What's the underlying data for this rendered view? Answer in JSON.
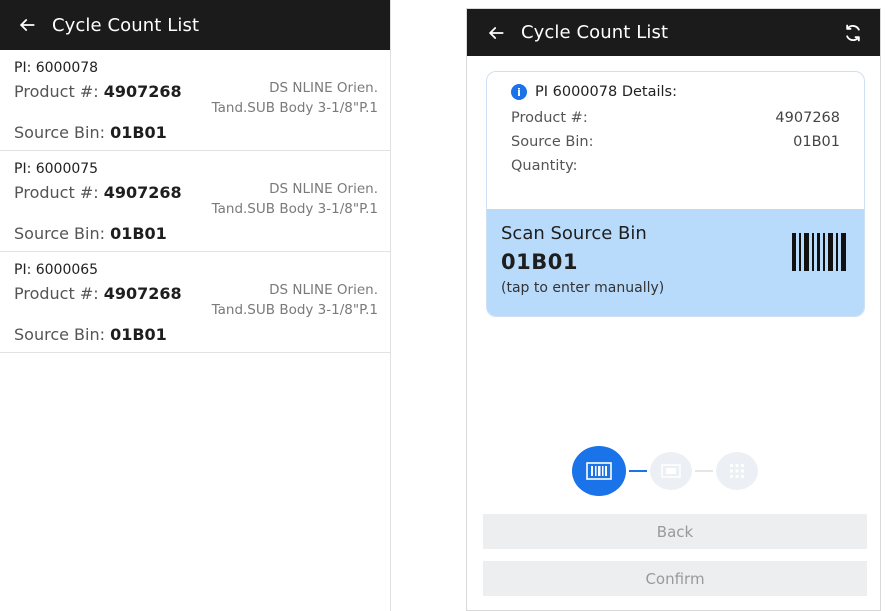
{
  "left_screen": {
    "title": "Cycle Count List",
    "items": [
      {
        "pi": "PI: 6000078",
        "product_label": "Product #: ",
        "product_value": "4907268",
        "desc_line1": "DS NLINE Orien.",
        "desc_line2": "Tand.SUB Body 3-1/8\"P.1",
        "source_label": "Source Bin: ",
        "source_value": "01B01"
      },
      {
        "pi": "PI: 6000075",
        "product_label": "Product #: ",
        "product_value": "4907268",
        "desc_line1": "DS NLINE Orien.",
        "desc_line2": "Tand.SUB Body 3-1/8\"P.1",
        "source_label": "Source Bin: ",
        "source_value": "01B01"
      },
      {
        "pi": "PI: 6000065",
        "product_label": "Product #: ",
        "product_value": "4907268",
        "desc_line1": "DS NLINE Orien.",
        "desc_line2": "Tand.SUB Body 3-1/8\"P.1",
        "source_label": "Source Bin: ",
        "source_value": "01B01"
      }
    ]
  },
  "right_screen": {
    "title": "Cycle Count List",
    "details": {
      "title": "PI 6000078 Details:",
      "product_label": "Product #:",
      "product_value": "4907268",
      "source_label": "Source Bin:",
      "source_value": "01B01",
      "quantity_label": "Quantity:",
      "quantity_value": ""
    },
    "scan": {
      "title": "Scan Source Bin",
      "value": "01B01",
      "hint": "(tap to enter manually)"
    },
    "stepper": {
      "current_step": 1,
      "total_steps": 3
    },
    "buttons": {
      "back": "Back",
      "confirm": "Confirm"
    }
  },
  "colors": {
    "topbar": "#1b1b1b",
    "accent": "#1a73e8",
    "scan_panel": "#b9dbfb",
    "button_bg": "#eceef0"
  },
  "icons": {
    "back": "arrow-left-icon",
    "refresh": "refresh-icon",
    "info": "info-icon",
    "barcode": "barcode-icon"
  }
}
